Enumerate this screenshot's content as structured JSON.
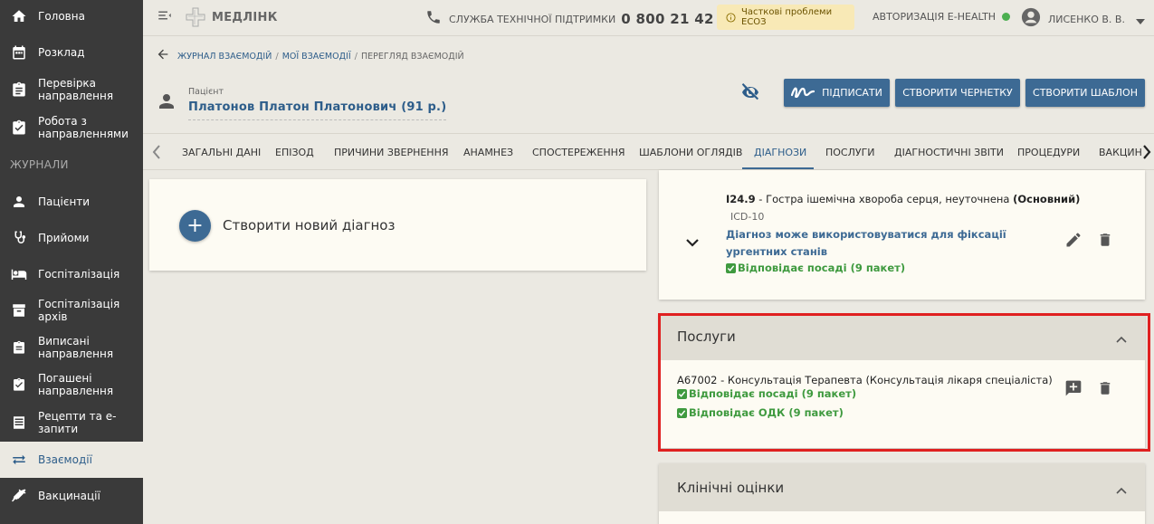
{
  "sidebar": {
    "items": [
      {
        "label": "Головна",
        "icon": "home-icon"
      },
      {
        "label": "Розклад",
        "icon": "calendar-icon"
      },
      {
        "label": "Перевірка направлення",
        "icon": "clipboard-check-icon"
      },
      {
        "label": "Робота з направленнями",
        "icon": "clipboard-icon"
      },
      {
        "label": "Пацієнти",
        "icon": "person-icon"
      },
      {
        "label": "Прийоми",
        "icon": "stethoscope-icon"
      },
      {
        "label": "Госпіталізація",
        "icon": "bed-icon"
      },
      {
        "label": "Госпіталізація архів",
        "icon": "archive-icon"
      },
      {
        "label": "Виписані направлення",
        "icon": "clipboard-out-icon"
      },
      {
        "label": "Погашені направлення",
        "icon": "clipboard-done-icon"
      },
      {
        "label": "Рецепти та е-запити",
        "icon": "list-icon"
      },
      {
        "label": "Взаємодії",
        "icon": "swap-icon"
      },
      {
        "label": "Вакцинації",
        "icon": "syringe-icon"
      }
    ],
    "section_label": "ЖУРНАЛИ",
    "active_color": "#2d5d8a"
  },
  "topbar": {
    "logo": "МЕДЛІНК",
    "support_label": "СЛУЖБА ТЕХНІЧНОЇ ПІДТРИМКИ",
    "support_phone": "0 800 21 42 00",
    "warning": "Часткові проблеми ЕСОЗ",
    "ehealth": "АВТОРИЗАЦІЯ E-HEALTH",
    "ehealth_status_color": "#4caf50",
    "user": "ЛИСЕНКО В. В."
  },
  "breadcrumb": {
    "items": [
      "ЖУРНАЛ ВЗАЄМОДІЙ",
      "МОЇ ВЗАЄМОДІЇ"
    ],
    "current": "ПЕРЕГЛЯД ВЗАЄМОДІЙ"
  },
  "patient": {
    "label": "Пацієнт",
    "name": "Платонов Платон Платонович (91 р.)"
  },
  "actions": {
    "sign": "ПІДПИСАТИ",
    "draft": "СТВОРИТИ ЧЕРНЕТКУ",
    "template": "СТВОРИТИ ШАБЛОН"
  },
  "tabs": [
    {
      "label": "ЗАГАЛЬНІ ДАНІ"
    },
    {
      "label": "ЕПІЗОД"
    },
    {
      "label": "ПРИЧИНИ ЗВЕРНЕННЯ"
    },
    {
      "label": "АНАМНЕЗ"
    },
    {
      "label": "СПОСТЕРЕЖЕННЯ"
    },
    {
      "label": "ШАБЛОНИ ОГЛЯДІВ"
    },
    {
      "label": "ДІАГНОЗИ"
    },
    {
      "label": "ПОСЛУГИ"
    },
    {
      "label": "ДІАГНОСТИЧНІ ЗВІТИ"
    },
    {
      "label": "ПРОЦЕДУРИ"
    },
    {
      "label": "ВАКЦИН"
    }
  ],
  "new_diagnosis": {
    "label": "Створити новий діагноз"
  },
  "diagnosis": {
    "code": "I24.9",
    "text": " - Гостра ішемічна хвороба серця, неуточнена ",
    "type": "(Основний)",
    "system": "ICD-10",
    "urgent_note": "Діагноз може використовуватися для фіксації ургентних станів",
    "match": "Відповідає посаді (9 пакет)"
  },
  "services": {
    "title": "Послуги",
    "line": "A67002 - Консультація Терапевта (Консультація лікаря спеціаліста)",
    "match_position": "Відповідає посаді (9 пакет)",
    "match_odk": "Відповідає ОДК (9 пакет)"
  },
  "clinical": {
    "title": "Клінічні оцінки"
  }
}
